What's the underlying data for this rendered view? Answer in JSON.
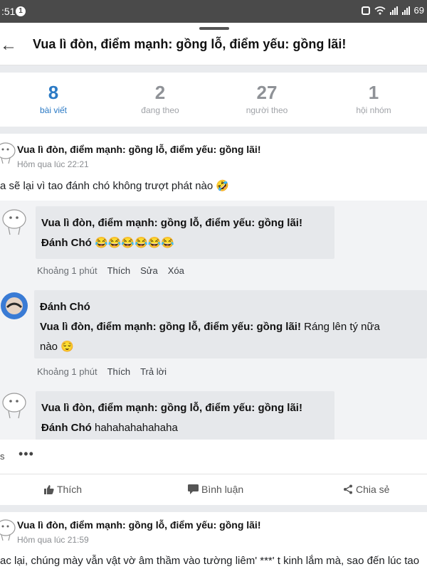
{
  "status_bar": {
    "time": ":51",
    "notif_count": "1",
    "battery": "69"
  },
  "header": {
    "title": "Vua lì đòn, điểm mạnh: gồng lỗ, điểm yếu: gồng lãi!"
  },
  "stats": [
    {
      "num": "8",
      "label": "bài viết"
    },
    {
      "num": "2",
      "label": "đang theo"
    },
    {
      "num": "27",
      "label": "người theo"
    },
    {
      "num": "1",
      "label": "hội nhóm"
    }
  ],
  "post1": {
    "author": "Vua lì đòn, điểm mạnh: gồng lỗ, điểm yếu: gồng lãi!",
    "time": "Hôm qua lúc 22:21",
    "text": "a sẽ lại vì tao đánh chó không trượt phát nào 🤣"
  },
  "comments": [
    {
      "author": "Vua lì đòn, điểm mạnh: gồng lỗ, điểm yếu: gồng lãi!",
      "mention": "Đánh Chó",
      "text": "😂😂😂😂😂😂",
      "actions": [
        "Khoảng 1 phút",
        "Thích",
        "Sửa",
        "Xóa"
      ]
    },
    {
      "author": "Đánh Chó",
      "mention": "Vua lì đòn, điểm mạnh: gồng lỗ, điểm yếu: gồng lãi!",
      "text": "Ráng lên tý nữa",
      "text2": "nào 😌",
      "actions": [
        "Khoảng 1 phút",
        "Thích",
        "Trả lời"
      ]
    },
    {
      "author": "Vua lì đòn, điểm mạnh: gồng lỗ, điểm yếu: gồng lãi!",
      "mention": "Đánh Chó",
      "text": "hahahahahahaha"
    }
  ],
  "more": {
    "label": "s",
    "dots": "•••"
  },
  "action_bar": {
    "like": "Thích",
    "comment": "Bình luận",
    "share": "Chia sẻ"
  },
  "post2": {
    "author": "Vua lì đòn, điểm mạnh: gồng lỗ, điểm yếu: gồng lãi!",
    "time": "Hôm qua lúc 21:59",
    "text": "ac lại, chúng mày vẫn vật vờ âm thầm vào tường liêm' ***' t kinh lắm mà, sao đến lúc tao"
  },
  "colors": {
    "accent": "#2b7ac5",
    "stat_gray": "#8f9297",
    "comment_bg": "#f2f3f5",
    "bubble_bg": "#e6e8eb"
  }
}
